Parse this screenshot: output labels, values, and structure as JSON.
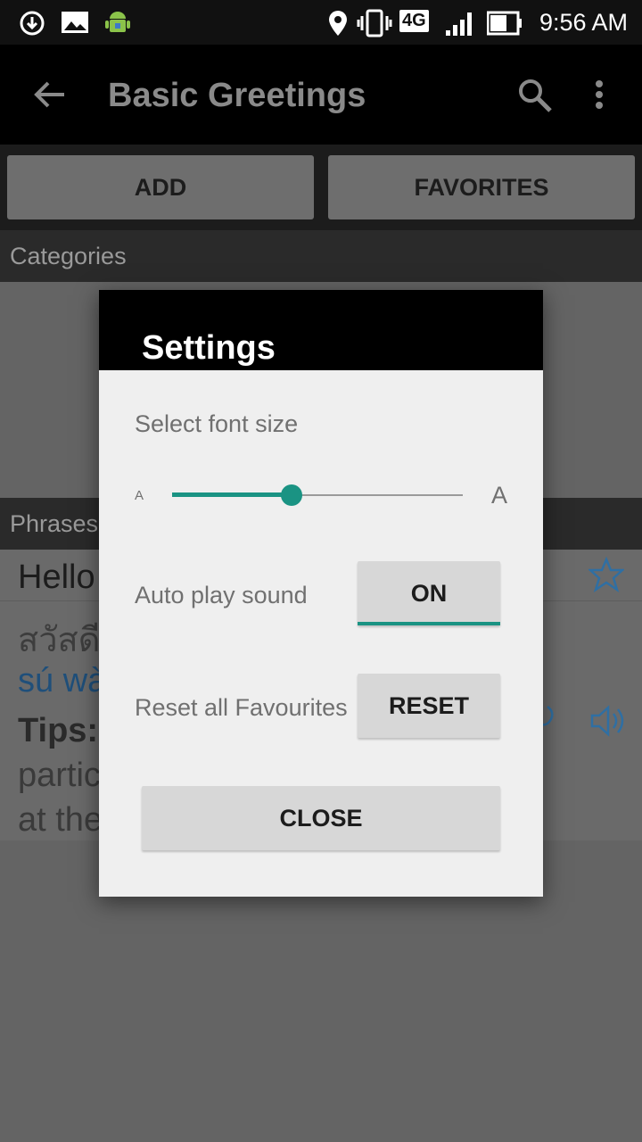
{
  "status_bar": {
    "time": "9:56 AM",
    "network": "4G",
    "icons": [
      "download-icon",
      "image-icon",
      "android-icon",
      "location-icon",
      "vibrate-icon",
      "signal-icon",
      "battery-icon"
    ]
  },
  "app_bar": {
    "title": "Basic Greetings",
    "icons": [
      "back-arrow-icon",
      "search-icon",
      "more-vert-icon"
    ]
  },
  "buttons": {
    "add": "ADD",
    "favorites": "FAVORITES"
  },
  "sections": {
    "categories": "Categories",
    "phrases": "Phrases"
  },
  "phrase": {
    "english": "Hello",
    "thai": "สวัสดี",
    "romanized": "sú wà",
    "tips_label": "Tips:",
    "tips_line1": "partic",
    "tips_line2": "at the"
  },
  "dialog": {
    "title": "Settings",
    "font_size_label": "Select font size",
    "font_size_small": "A",
    "font_size_large": "A",
    "font_size_level": 0.41,
    "auto_play_label": "Auto play sound",
    "auto_play_button": "ON",
    "reset_label": "Reset all Favourites",
    "reset_button": "RESET",
    "close_button": "CLOSE"
  },
  "colors": {
    "accent": "#1a9383",
    "dialog_bg": "#efefef",
    "overlay": "#646464",
    "star": "#2f6fa3"
  }
}
